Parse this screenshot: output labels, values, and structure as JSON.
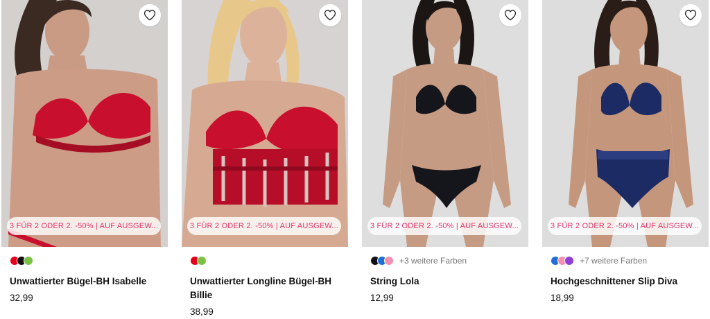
{
  "products": [
    {
      "name": "Unwattierter Bügel-BH Isabelle",
      "price": "32,99",
      "promo": "3 FÜR 2 ODER 2. -50% | AUF AUSGEW...",
      "swatches": [
        "#e4001b",
        "#111111",
        "#7cc242"
      ],
      "more_colors": "",
      "wishlist_icon": "heart-outline-icon"
    },
    {
      "name": "Unwattierter Longline Bügel-BH Billie",
      "price": "38,99",
      "promo": "3 FÜR 2 ODER 2. -50% | AUF AUSGEW...",
      "swatches": [
        "#e4001b",
        "#7cc242"
      ],
      "more_colors": "",
      "wishlist_icon": "heart-outline-icon"
    },
    {
      "name": "String Lola",
      "price": "12,99",
      "promo": "3 FÜR 2 ODER 2. -50% | AUF AUSGEW...",
      "swatches": [
        "#111111",
        "#1f6fd6",
        "#f48fb1"
      ],
      "more_colors": "+3 weitere Farben",
      "wishlist_icon": "heart-outline-icon"
    },
    {
      "name": "Hochgeschnittener Slip Diva",
      "price": "18,99",
      "promo": "3 FÜR 2 ODER 2. -50% | AUF AUSGEW...",
      "swatches": [
        "#1f6fd6",
        "#f48fb1",
        "#8e3fd6"
      ],
      "more_colors": "+7 weitere Farben",
      "wishlist_icon": "heart-outline-icon"
    }
  ],
  "colors": {
    "promo_text": "#e0336c",
    "lingerie_red": "#c8102e",
    "lingerie_navy": "#1c2b63",
    "lingerie_black": "#15161c",
    "studio_bg": "#dcdcdc"
  }
}
